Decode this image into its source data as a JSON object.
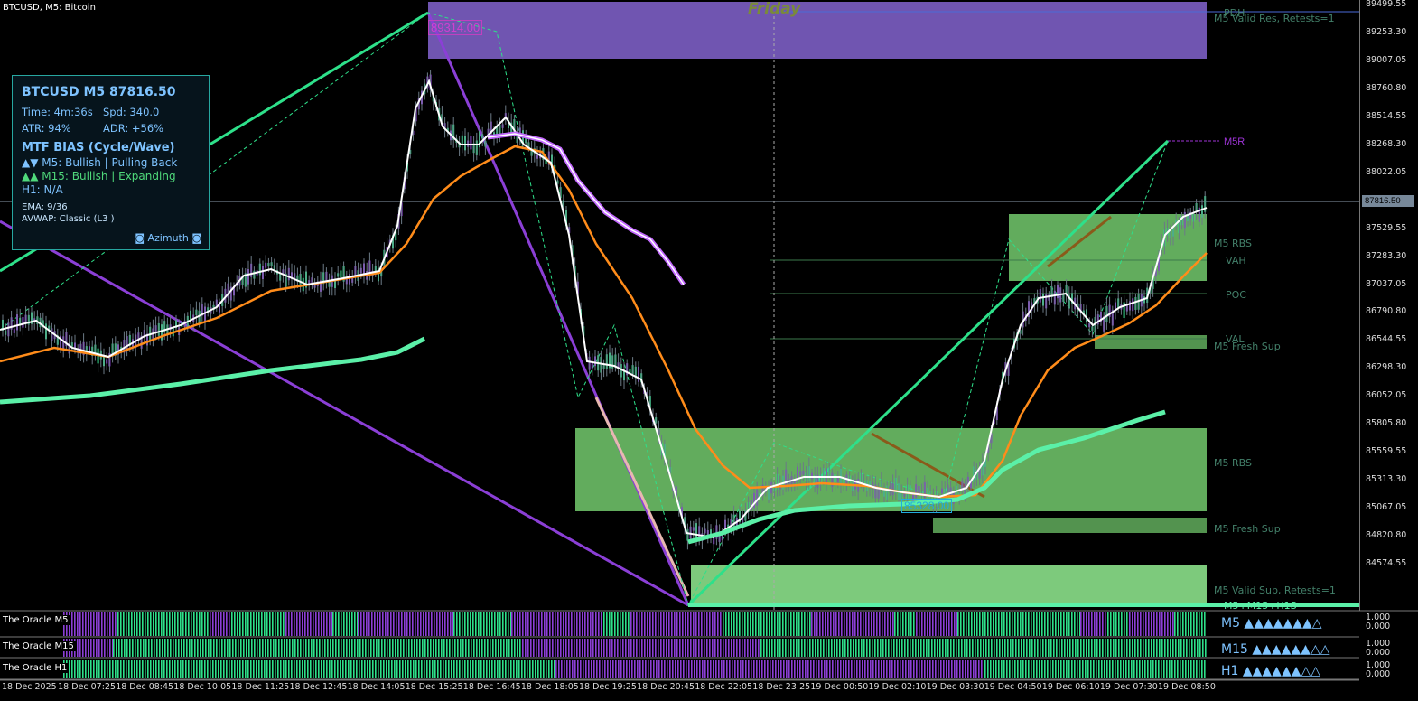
{
  "symbol": "BTCUSD, M5:  Bitcoin",
  "info_panel": {
    "title": "BTCUSD M5 87816.50",
    "time_label": "Time: 4m:36s",
    "spd_label": "Spd: 340.0",
    "atr_label": "ATR:   94%",
    "adr_label": "ADR: +56%",
    "bias_title": "MTF BIAS (Cycle/Wave)",
    "m5_line": "▲▼ M5: Bullish | Pulling Back",
    "m15_line": "▲▲ M15: Bullish | Expanding",
    "h1_line": "H1: N/A",
    "ema_line": "EMA: 9/36",
    "avwap_line": "AVWAP: Classic (L3 )",
    "brand": "◙ Azimuth ◙"
  },
  "session_label": "Friday",
  "markers": {
    "high_tag": "89314.00",
    "low_box": "85328.00",
    "m5r": "M5R"
  },
  "zone_labels": {
    "pdh": "PDH",
    "res_valid": "M5 Valid Res, Retests=1",
    "rbs1": "M5 RBS",
    "vah": "VAH",
    "poc": "POC",
    "val": "VAL",
    "fresh_sup1": "M5 Fresh Sup",
    "rbs2": "M5 RBS",
    "fresh_sup2": "M5 Fresh Sup",
    "valid_sup": "M5 Valid Sup, Retests=1",
    "mtf": "M5+M15+H1S"
  },
  "price_axis": [
    "89499.55",
    "89253.30",
    "89007.05",
    "88760.80",
    "88514.55",
    "88268.30",
    "88022.05",
    "87775.80",
    "87529.55",
    "87283.30",
    "87037.05",
    "86790.80",
    "86544.55",
    "86298.30",
    "86052.05",
    "85805.80",
    "85559.55",
    "85313.30",
    "85067.05",
    "84820.80",
    "84574.55"
  ],
  "current_price": "87816.50",
  "time_axis": [
    "18 Dec 2025",
    "18 Dec 07:25",
    "18 Dec 08:45",
    "18 Dec 10:05",
    "18 Dec 11:25",
    "18 Dec 12:45",
    "18 Dec 14:05",
    "18 Dec 15:25",
    "18 Dec 16:45",
    "18 Dec 18:05",
    "18 Dec 19:25",
    "18 Dec 20:45",
    "18 Dec 22:05",
    "18 Dec 23:25",
    "19 Dec 00:50",
    "19 Dec 02:10",
    "19 Dec 03:30",
    "19 Dec 04:50",
    "19 Dec 06:10",
    "19 Dec 07:30",
    "19 Dec 08:50"
  ],
  "indicators": [
    {
      "name": "The Oracle M5",
      "status": "M5 ▲▲▲▲▲▲▲△",
      "scale_top": "1.000",
      "scale_bottom": "0.000"
    },
    {
      "name": "The Oracle M15",
      "status": "M15 ▲▲▲▲▲▲△△",
      "scale_top": "1.000",
      "scale_bottom": "0.000"
    },
    {
      "name": "The Oracle H1",
      "status": "H1 ▲▲▲▲▲▲△△",
      "scale_top": "1.000",
      "scale_bottom": "0.000"
    }
  ],
  "colors": {
    "bull": "#2ee08a",
    "bear": "#8b3fd6",
    "ema_fast": "#ffffff",
    "ema_slow": "#ff8c1a",
    "avwap": "#5bf0a8",
    "zone_green": "#6fc46a",
    "zone_purple": "#7a5cc0"
  }
}
